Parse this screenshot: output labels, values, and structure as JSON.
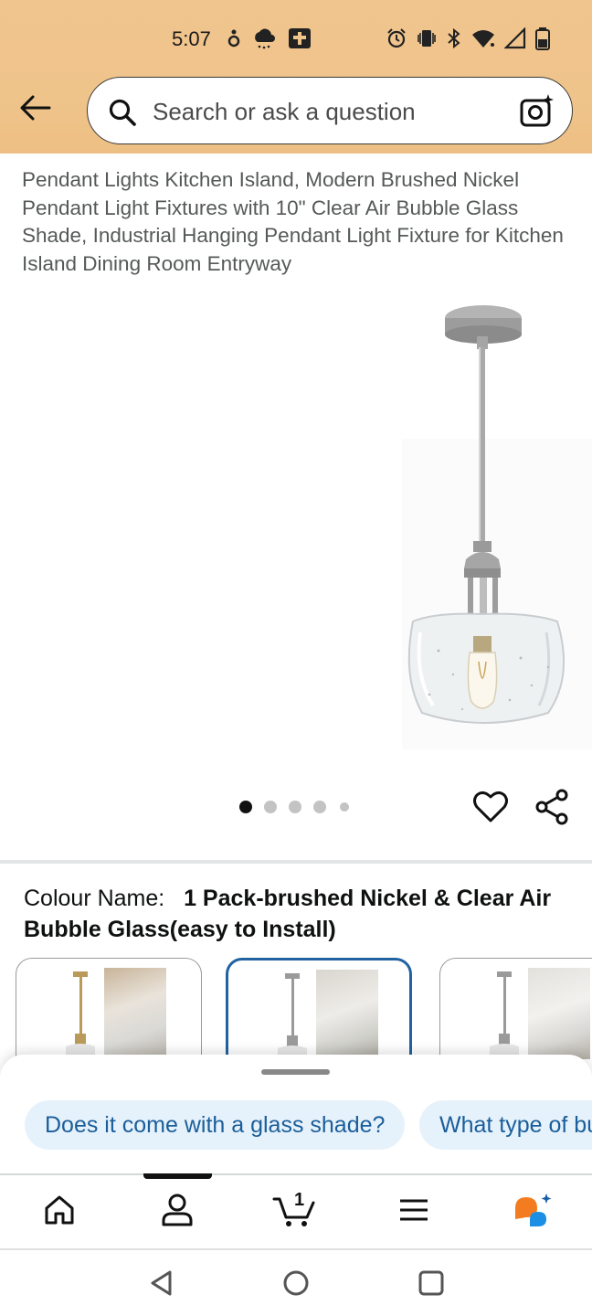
{
  "status_bar": {
    "time": "5:07",
    "left_icons": [
      "location-icon",
      "weather-icon",
      "bible-app-icon"
    ],
    "right_icons": [
      "alarm-icon",
      "vibrate-icon",
      "bluetooth-icon",
      "wifi-icon",
      "signal-icon",
      "battery-icon"
    ]
  },
  "header": {
    "back_icon": "back-arrow-icon",
    "search_placeholder": "Search or ask a question",
    "camera_icon": "camera-search-icon",
    "background_color": "#efc48b"
  },
  "product": {
    "title": "Pendant Lights Kitchen Island, Modern Brushed Nickel Pendant Light Fixtures with 10\" Clear Air Bubble Glass Shade, Industrial Hanging Pendant Light Fixture for Kitchen Island Dining Room Entryway",
    "carousel": {
      "total_dots": 5,
      "active_index": 0
    },
    "actions": [
      "heart-icon",
      "share-icon"
    ]
  },
  "variation": {
    "label": "Colour Name:",
    "value": "1 Pack-brushed Nickel & Clear Air Bubble Glass(easy to Install)",
    "swatches": [
      {
        "finish": "brass",
        "selected": false
      },
      {
        "finish": "brushed-nickel",
        "selected": true
      },
      {
        "finish": "brushed-nickel",
        "selected": false
      }
    ],
    "selected_color": "#2162a1"
  },
  "suggestions": {
    "chips": [
      "Does it come with a glass shade?",
      "What type of bulb"
    ]
  },
  "bottom_nav": {
    "items": [
      "home-icon",
      "account-icon",
      "cart-icon",
      "menu-icon",
      "rufus-icon"
    ],
    "cart_count": "1",
    "active_index": 1
  },
  "system_nav": [
    "back-triangle-icon",
    "home-circle-icon",
    "recents-square-icon"
  ]
}
